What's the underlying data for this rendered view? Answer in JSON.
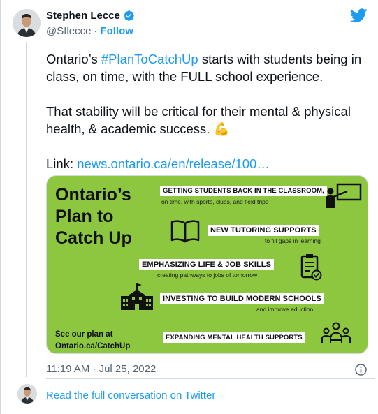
{
  "author": {
    "name": "Stephen Lecce",
    "handle": "@Sflecce",
    "separator": "·",
    "follow_label": "Follow"
  },
  "tweet": {
    "line1_before": "Ontario’s ",
    "hashtag": "#PlanToCatchUp",
    "line1_after": " starts with students being in class, on time, with the FULL school experience.",
    "paragraph2": "That stability will be critical for their mental & physical health, & academic success. ",
    "emoji": "💪",
    "link_label": "Link: ",
    "link_text": "news.ontario.ca/en/release/100…"
  },
  "graphic": {
    "background": "#8dc63f",
    "headline": [
      "Ontario’s",
      "Plan to",
      "Catch Up"
    ],
    "see_plan": [
      "See our plan at",
      "Ontario.ca/CatchUp"
    ],
    "items": [
      {
        "title": "GETTING STUDENTS BACK IN THE CLASSROOM,",
        "subtitle": "on time, with sports, clubs, and field trips",
        "icon": "classroom-teacher-icon"
      },
      {
        "title": "NEW TUTORING SUPPORTS",
        "subtitle": "to fill gaps in learning",
        "icon": "open-book-icon"
      },
      {
        "title": "EMPHASIZING LIFE & JOB SKILLS",
        "subtitle": "creating pathways to jobs of tomorrow",
        "icon": "checklist-icon"
      },
      {
        "title": "INVESTING TO BUILD MODERN SCHOOLS",
        "subtitle": "and improve eduction",
        "icon": "school-building-icon"
      },
      {
        "title": "EXPANDING MENTAL HEALTH SUPPORTS",
        "subtitle": "",
        "icon": "group-support-icon"
      }
    ]
  },
  "meta": {
    "timestamp": "11:19 AM · Jul 25, 2022",
    "read_more": "Read the full conversation on Twitter"
  },
  "colors": {
    "link": "#1d9bf0",
    "muted": "#536471",
    "graphic_green": "#8dc63f"
  }
}
